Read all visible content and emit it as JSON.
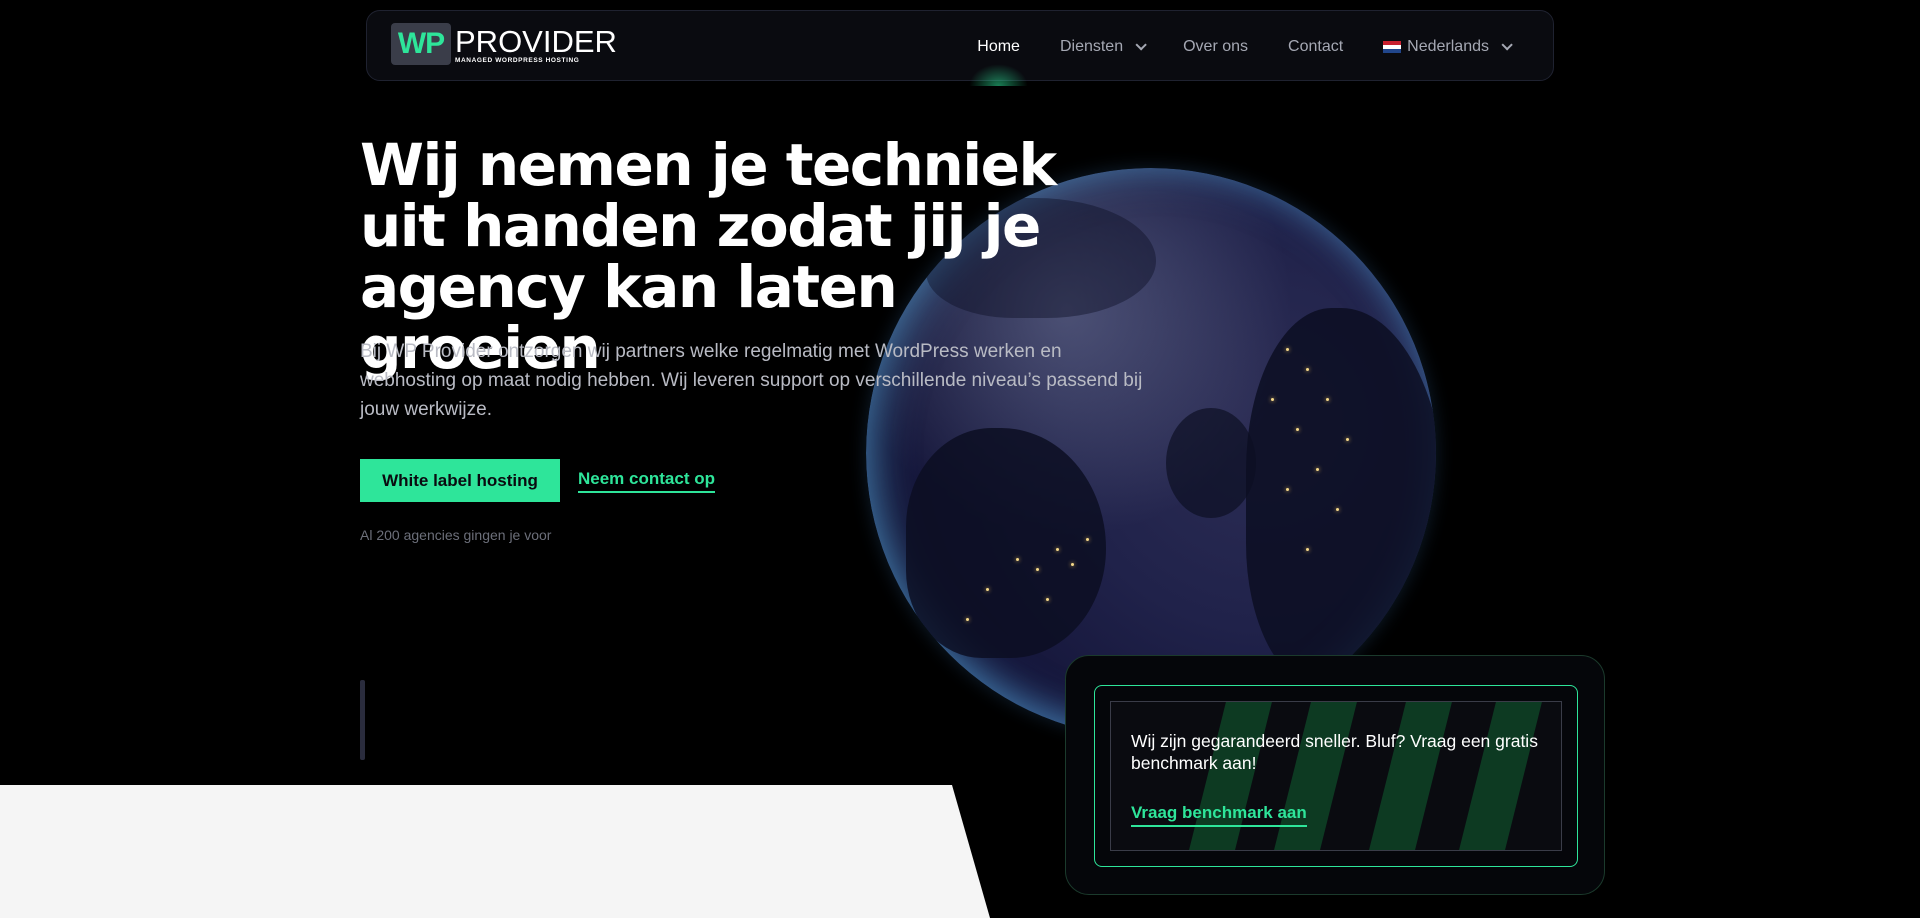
{
  "nav": {
    "logo": {
      "mark": "WP",
      "name": "PROVIDER",
      "tagline": "MANAGED WORDPRESS HOSTING"
    },
    "items": [
      {
        "label": "Home",
        "active": true
      },
      {
        "label": "Diensten",
        "dropdown": true
      },
      {
        "label": "Over ons"
      },
      {
        "label": "Contact"
      },
      {
        "label": "Nederlands",
        "dropdown": true,
        "icon": "flag-nl-icon"
      }
    ]
  },
  "hero": {
    "title": "Wij nemen je techniek uit handen zodat jij je agency kan laten groeien",
    "lead": "Bij WP Provider ontzorgen wij partners welke regelmatig met WordPress werken en webhosting op maat nodig hebben. Wij leveren support op verschillende niveau’s passend bij jouw werkwijze.",
    "primary_button": "White label hosting",
    "secondary_link": "Neem contact op",
    "agencies": "Al 200 agencies gingen je voor"
  },
  "benchmark": {
    "text": "Wij zijn gegarandeerd sneller. Bluf? Vraag een gratis benchmark aan!",
    "link": "Vraag benchmark aan"
  },
  "colors": {
    "accent": "#2ee59a",
    "background": "#000000",
    "nav_bg": "#0a0b10",
    "text_muted": "#b9bbc4",
    "light_panel": "#f5f5f5"
  }
}
